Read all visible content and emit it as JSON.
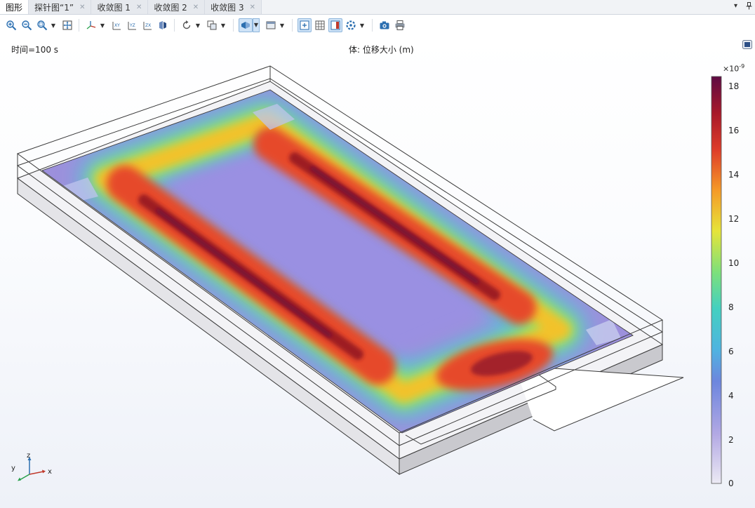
{
  "tabs": [
    {
      "label": "图形",
      "active": true,
      "closable": false
    },
    {
      "label": "探针图“1”",
      "active": false,
      "closable": true
    },
    {
      "label": "收敛图 1",
      "active": false,
      "closable": true
    },
    {
      "label": "收敛图 2",
      "active": false,
      "closable": true
    },
    {
      "label": "收敛图 3",
      "active": false,
      "closable": true
    }
  ],
  "tab_controls": {
    "menu": "▾",
    "pin": "📌"
  },
  "toolbar": {
    "buttons": [
      "zoom-in-icon",
      "zoom-out-icon",
      "zoom-box-icon",
      "zoom-extents-icon",
      "axis-orientation-icon",
      "view-xy-icon",
      "view-yz-icon",
      "view-zx-icon",
      "perspective-icon",
      "reset-view-icon",
      "select-icon",
      "transparency-icon",
      "view-dropdown-icon",
      "scene-light-icon",
      "grid-icon",
      "colorbar-icon",
      "render-icon",
      "camera-icon",
      "print-icon"
    ]
  },
  "graphics": {
    "time_label": "时间=100 s",
    "plot_title": "体: 位移大小 (m)",
    "colors": {
      "outline": "#3a3a3a",
      "substrate_side": "#d4d5d9",
      "plate_tint": "#9a8fdc"
    }
  },
  "colorbar": {
    "multiplier_base": "×10",
    "multiplier_exp": "-9",
    "min": 0,
    "max": 18.5,
    "ticks": [
      "18",
      "16",
      "14",
      "12",
      "10",
      "8",
      "6",
      "4",
      "2",
      "0"
    ],
    "colormap": [
      "#eceaf4",
      "#9b8fdc",
      "#5c8fe0",
      "#3fc7d8",
      "#5ddc8c",
      "#e8e63a",
      "#f5a628",
      "#e04a2a",
      "#b51d22",
      "#6a0d3f"
    ]
  },
  "triad": {
    "x": "x",
    "y": "y",
    "z": "z"
  }
}
